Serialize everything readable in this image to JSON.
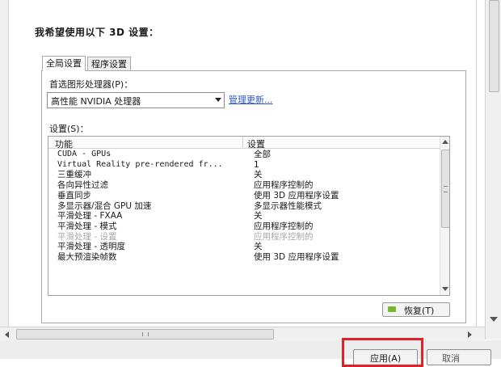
{
  "heading": "我希望使用以下 3D 设置：",
  "tabs": [
    {
      "label": "全局设置",
      "active": true
    },
    {
      "label": "程序设置",
      "active": false
    }
  ],
  "gpu": {
    "label": "首选图形处理器(P)：",
    "selected": "高性能 NVIDIA 处理器",
    "manage_link": "管理更新..."
  },
  "settings": {
    "label": "设置(S)：",
    "columns": [
      "功能",
      "设置"
    ],
    "rows": [
      {
        "feature": "CUDA - GPUs",
        "value": "全部"
      },
      {
        "feature": "Virtual Reality pre-rendered fr...",
        "value": "1"
      },
      {
        "feature": "三重缓冲",
        "value": "关"
      },
      {
        "feature": "各向异性过滤",
        "value": "应用程序控制的"
      },
      {
        "feature": "垂直同步",
        "value": "使用 3D 应用程序设置"
      },
      {
        "feature": "多显示器/混合 GPU 加速",
        "value": "多显示器性能模式"
      },
      {
        "feature": "平滑处理 - FXAA",
        "value": "关"
      },
      {
        "feature": "平滑处理 - 模式",
        "value": "应用程序控制的"
      },
      {
        "feature": "平滑处理 - 设置",
        "value": "应用程序控制的",
        "disabled": true
      },
      {
        "feature": "平滑处理 - 透明度",
        "value": "关"
      },
      {
        "feature": "最大预渲染帧数",
        "value": "使用 3D 应用程序设置"
      }
    ]
  },
  "restore_button": "恢复(T)",
  "apply_button": "应用(A)",
  "cancel_button": "取消",
  "colors": {
    "highlight": "#e3202a",
    "link": "#2a56c6",
    "nvidia_green": "#79b630"
  },
  "icons": {
    "dropdown": "chevron-down-icon",
    "restore": "nvidia-logo-icon"
  }
}
